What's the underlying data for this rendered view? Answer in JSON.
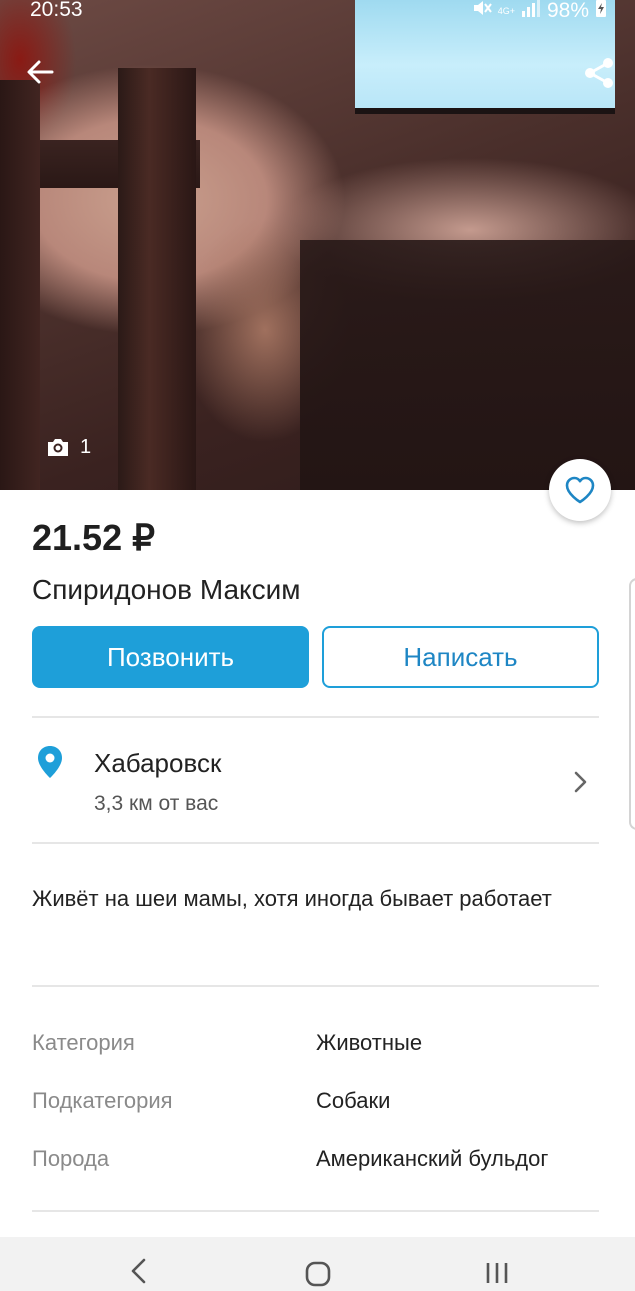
{
  "statusbar": {
    "time": "20:53",
    "network": "4G+",
    "battery": "98%"
  },
  "photo": {
    "count": "1"
  },
  "listing": {
    "price": "21.52 ₽",
    "seller": "Спиридонов Максим",
    "call_label": "Позвонить",
    "write_label": "Написать",
    "city": "Хабаровск",
    "distance": "3,3 км от вас",
    "description": "Живёт на шеи мамы, хотя иногда бывает работает"
  },
  "attributes": [
    {
      "label": "Категория",
      "value": "Животные"
    },
    {
      "label": "Подкатегория",
      "value": "Собаки"
    },
    {
      "label": "Порода",
      "value": "Американский бульдог"
    }
  ],
  "colors": {
    "accent": "#1e9fd9",
    "accent_text": "#1e86c4",
    "label_gray": "#8a8a8a"
  },
  "icons": [
    "back-arrow-icon",
    "share-icon",
    "camera-icon",
    "heart-icon",
    "location-pin-icon",
    "chevron-right-icon"
  ]
}
